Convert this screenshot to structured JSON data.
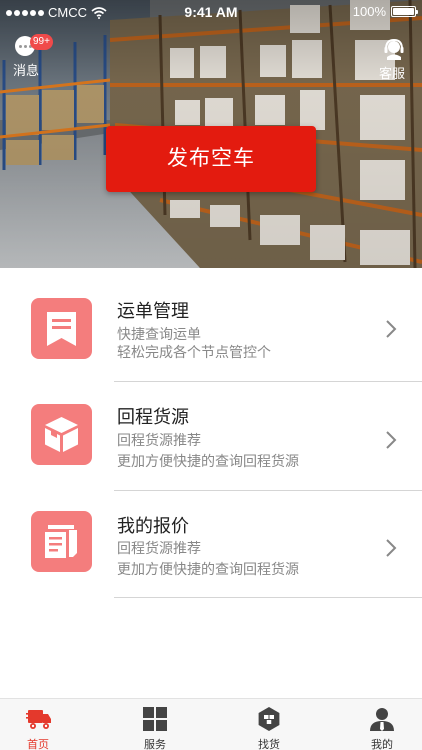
{
  "status_bar": {
    "carrier": "CMCC",
    "time": "9:41 AM",
    "battery": "100%",
    "battery_level": 1.0
  },
  "header": {
    "messages_label": "消息",
    "messages_badge": "99+",
    "messages_icon": "chat-bubble-icon",
    "support_label": "客服",
    "support_icon": "headset-agent-icon"
  },
  "hero": {
    "publish_button": "发布空车"
  },
  "menu": [
    {
      "title": "运单管理",
      "line1": "快捷查询运单",
      "line2": "轻松完成各个节点管控个",
      "icon": "bookmark-doc-icon"
    },
    {
      "title": "回程货源",
      "line1": "回程货源推荐",
      "line2": "更加方便快捷的查询回程货源",
      "icon": "box-icon"
    },
    {
      "title": "我的报价",
      "line1": "回程货源推荐",
      "line2": "更加方便快捷的查询回程货源",
      "icon": "documents-icon"
    }
  ],
  "tabs": [
    {
      "label": "首页",
      "icon": "truck-icon",
      "active": true
    },
    {
      "label": "服务",
      "icon": "grid-icon",
      "active": false
    },
    {
      "label": "找货",
      "icon": "cargo-hex-icon",
      "active": false
    },
    {
      "label": "我的",
      "icon": "user-icon",
      "active": false
    }
  ],
  "colors": {
    "accent": "#e31b0f",
    "icon_bg": "#f47d7d",
    "tab_active": "#e4392c",
    "badge": "#f04a4a"
  }
}
